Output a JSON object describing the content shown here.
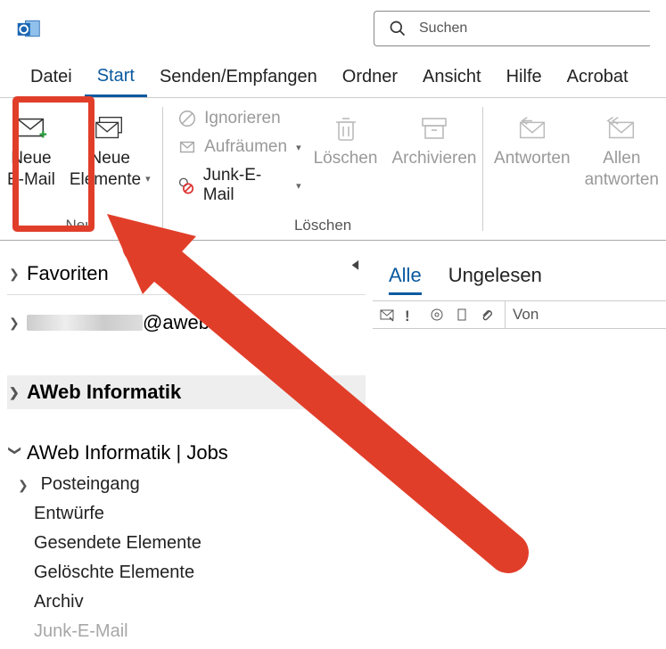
{
  "app": {
    "name": "Outlook",
    "search_placeholder": "Suchen"
  },
  "tabs": {
    "datei": "Datei",
    "start": "Start",
    "senden": "Senden/Empfangen",
    "ordner": "Ordner",
    "ansicht": "Ansicht",
    "hilfe": "Hilfe",
    "acrobat": "Acrobat"
  },
  "ribbon": {
    "neu": {
      "label": "Neu",
      "neue_email_1": "Neue",
      "neue_email_2": "E-Mail",
      "neue_elemente_1": "Neue",
      "neue_elemente_2": "Elemente"
    },
    "loeschen": {
      "label": "Löschen",
      "ignorieren": "Ignorieren",
      "aufraeumen": "Aufräumen",
      "junk": "Junk-E-Mail",
      "loeschen_btn": "Löschen",
      "archivieren": "Archivieren"
    },
    "antworten": {
      "antworten": "Antworten",
      "allen_1": "Allen",
      "allen_2": "antworten"
    }
  },
  "nav": {
    "favoriten": "Favoriten",
    "account_suffix": "@aweb.ch",
    "aweb": "AWeb Informatik",
    "jobs": "AWeb Informatik | Jobs",
    "posteingang": "Posteingang",
    "entwuerfe": "Entwürfe",
    "gesendet": "Gesendete Elemente",
    "geloescht": "Gelöschte Elemente",
    "archiv": "Archiv",
    "junk": "Junk-E-Mail"
  },
  "maillist": {
    "alle": "Alle",
    "ungelesen": "Ungelesen",
    "von": "Von"
  }
}
